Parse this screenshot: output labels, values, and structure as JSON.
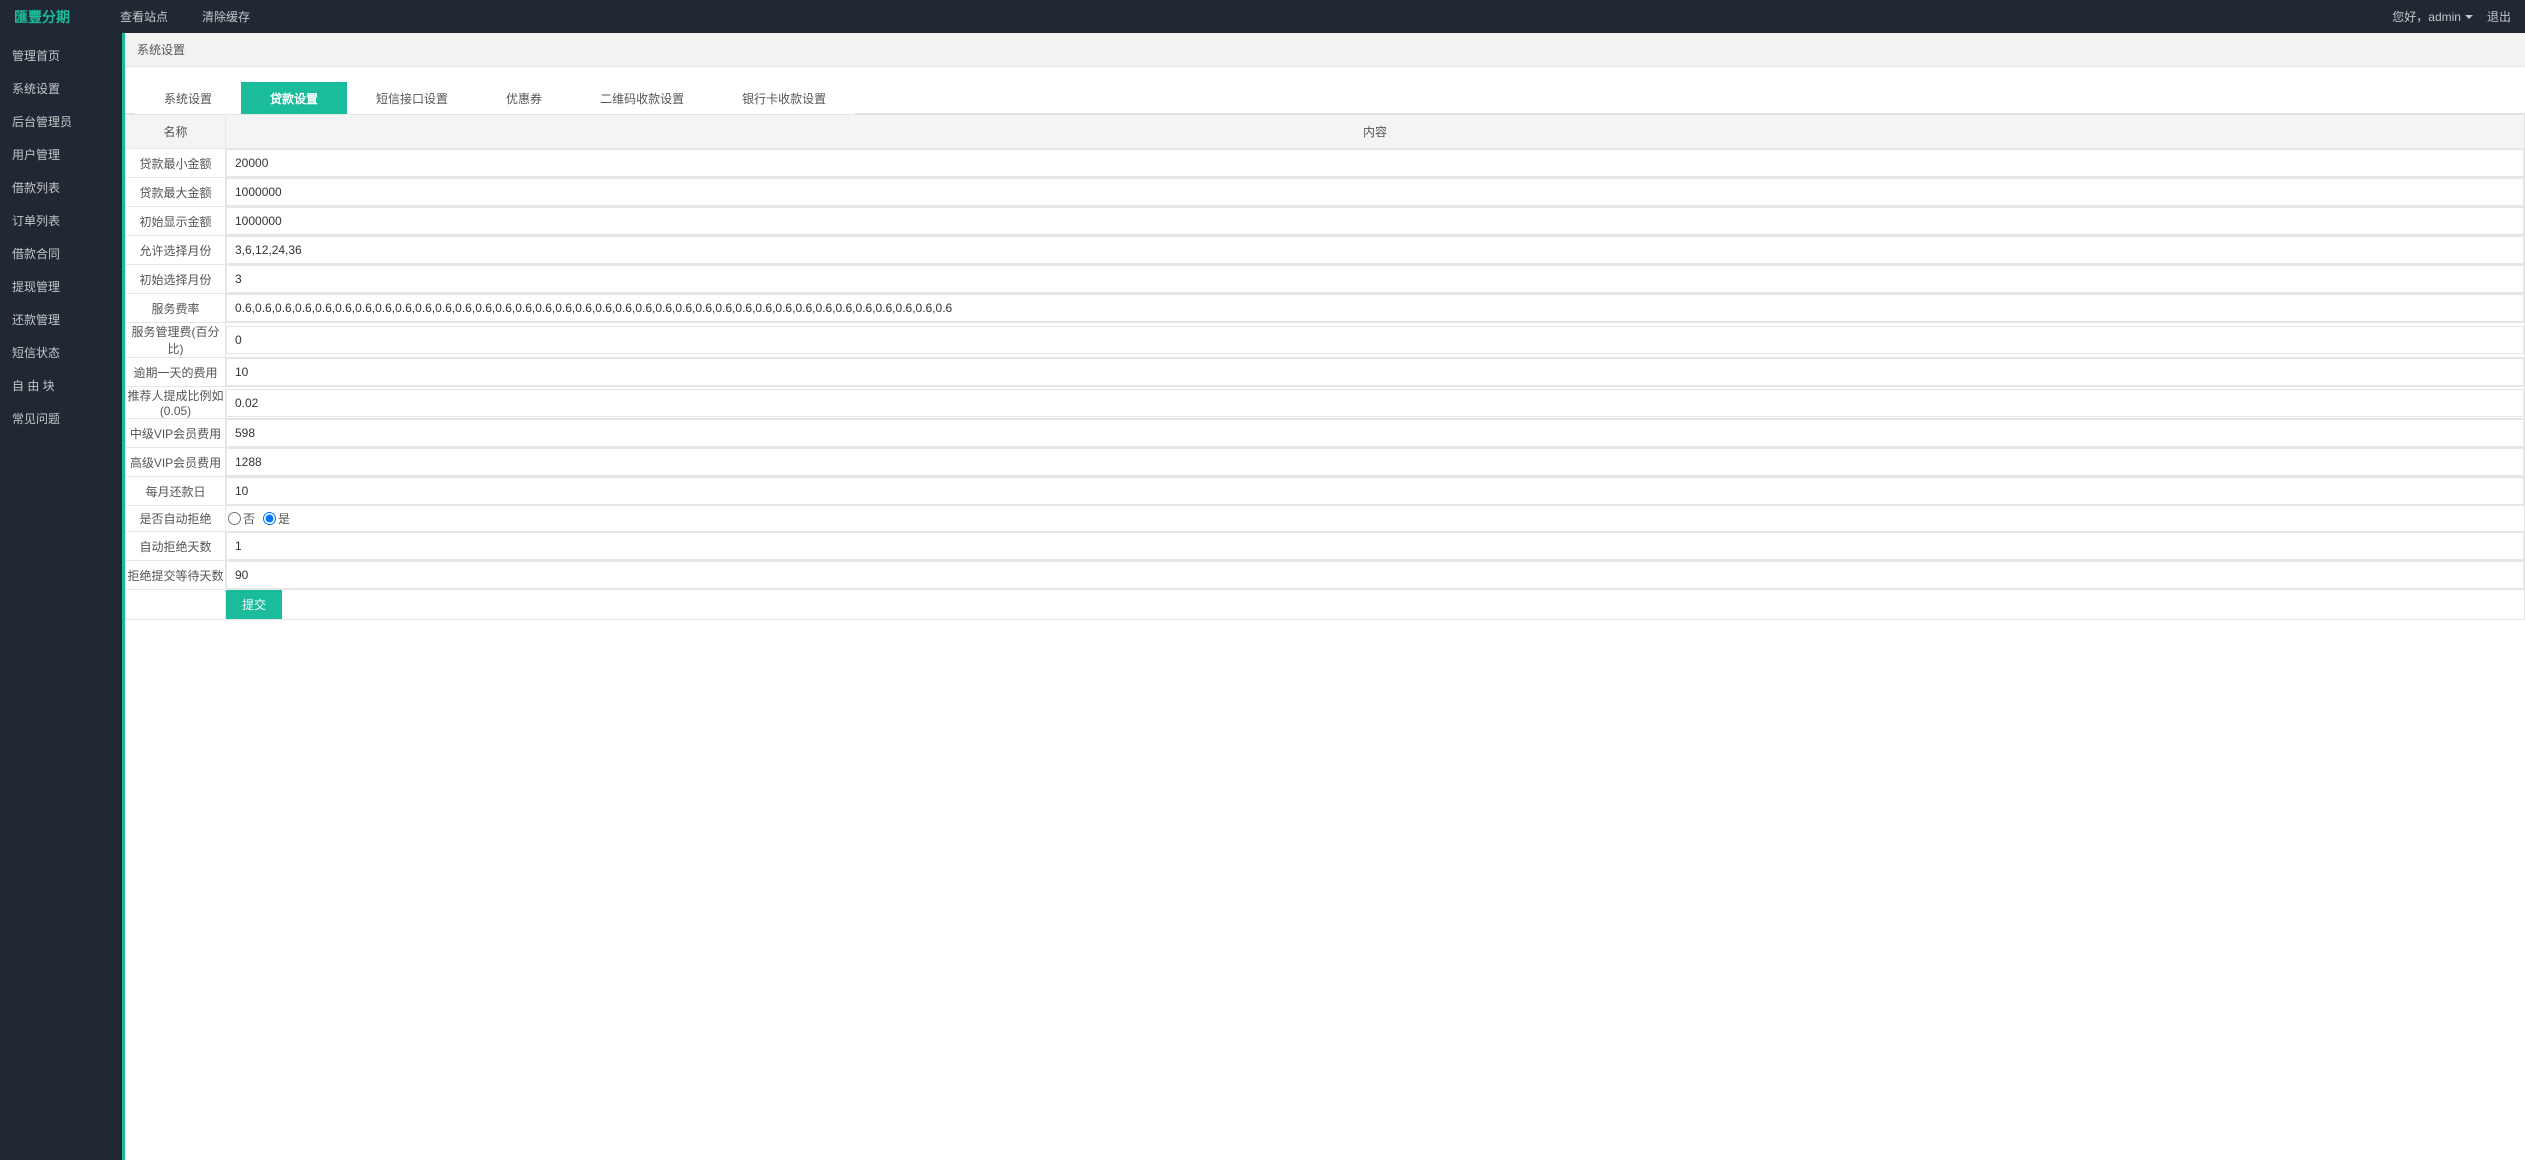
{
  "brand": "匯豐分期",
  "top": {
    "view_site": "查看站点",
    "clear_cache": "清除缓存",
    "greeting": "您好，admin",
    "logout": "退出"
  },
  "sidebar": {
    "items": [
      "管理首页",
      "系统设置",
      "后台管理员",
      "用户管理",
      "借款列表",
      "订单列表",
      "借款合同",
      "提现管理",
      "还款管理",
      "短信状态",
      "自 由 块",
      "常见问题"
    ]
  },
  "breadcrumb": "系统设置",
  "tabs": [
    "系统设置",
    "贷款设置",
    "短信接口设置",
    "优惠券",
    "二维码收款设置",
    "银行卡收款设置"
  ],
  "active_tab_index": 1,
  "table_headers": {
    "name": "名称",
    "content": "内容"
  },
  "fields": [
    {
      "label": "贷款最小金额",
      "value": "20000"
    },
    {
      "label": "贷款最大金额",
      "value": "1000000"
    },
    {
      "label": "初始显示金额",
      "value": "1000000"
    },
    {
      "label": "允许选择月份",
      "value": "3,6,12,24,36"
    },
    {
      "label": "初始选择月份",
      "value": "3"
    },
    {
      "label": "服务费率",
      "value": "0.6,0.6,0.6,0.6,0.6,0.6,0.6,0.6,0.6,0.6,0.6,0.6,0.6,0.6,0.6,0.6,0.6,0.6,0.6,0.6,0.6,0.6,0.6,0.6,0.6,0.6,0.6,0.6,0.6,0.6,0.6,0.6,0.6,0.6,0.6,0.6"
    },
    {
      "label": "服务管理费(百分比)",
      "value": "0"
    },
    {
      "label": "逾期一天的费用",
      "value": "10"
    },
    {
      "label": "推荐人提成比例如(0.05)",
      "value": "0.02"
    },
    {
      "label": "中级VIP会员费用",
      "value": "598"
    },
    {
      "label": "高级VIP会员费用",
      "value": "1288"
    },
    {
      "label": "每月还款日",
      "value": "10"
    }
  ],
  "auto_reject": {
    "label": "是否自动拒绝",
    "no": "否",
    "yes": "是",
    "selected": "yes"
  },
  "fields_after": [
    {
      "label": "自动拒绝天数",
      "value": "1"
    },
    {
      "label": "拒绝提交等待天数",
      "value": "90"
    }
  ],
  "submit_label": "提交"
}
